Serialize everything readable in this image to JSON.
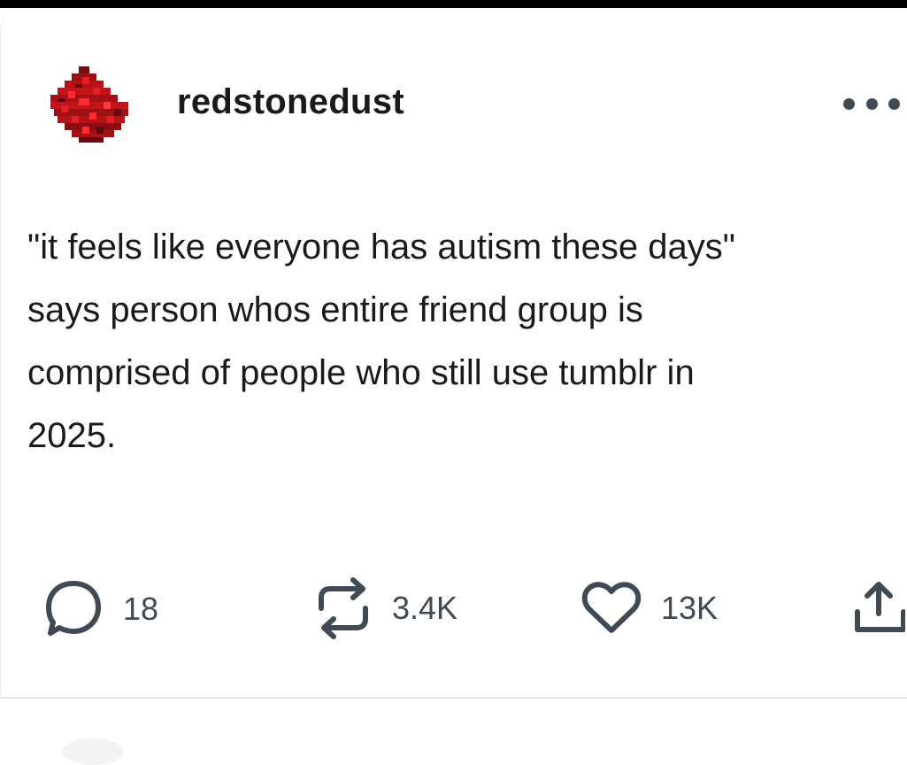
{
  "post": {
    "username": "redstonedust",
    "body": "\"it feels like everyone has autism these days\"\nsays person whos entire friend group is\ncomprised of people who still use tumblr in\n2025.",
    "more_icon": "ellipsis-icon",
    "avatar_icon": "redstone-dust-avatar"
  },
  "actions": {
    "reply_count": "18",
    "reblog_count": "3.4K",
    "like_count": "13K",
    "reply_icon": "speech-bubble-icon",
    "reblog_icon": "reblog-icon",
    "like_icon": "heart-icon",
    "share_icon": "share-icon"
  },
  "colors": {
    "text": "#1a1a1a",
    "icon": "#3f4a55",
    "avatar_red": "#c4141b",
    "background": "#ffffff"
  }
}
